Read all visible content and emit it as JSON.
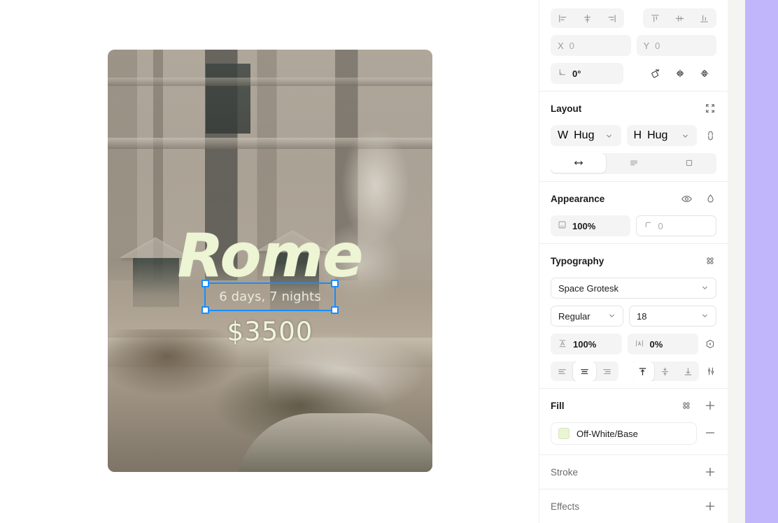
{
  "canvas": {
    "artboard": {
      "title": "Rome",
      "price": "$3500",
      "selected_text": "6 days, 7 nights"
    },
    "selection_color": "#1a8cff",
    "background": "#ffffff"
  },
  "panel": {
    "transform": {
      "align_horizontal": [
        {
          "name": "align-left-icon",
          "label": "Align left"
        },
        {
          "name": "align-center-horizontal-icon",
          "label": "Align horizontal centers"
        },
        {
          "name": "align-right-icon",
          "label": "Align right"
        }
      ],
      "align_vertical": [
        {
          "name": "align-top-icon",
          "label": "Align top"
        },
        {
          "name": "align-center-vertical-icon",
          "label": "Align vertical centers"
        },
        {
          "name": "align-bottom-icon",
          "label": "Align bottom"
        }
      ],
      "x": {
        "label": "X",
        "value": "0"
      },
      "y": {
        "label": "Y",
        "value": "0"
      },
      "rotation": {
        "label": "rotation-icon",
        "value": "0°"
      },
      "tools": [
        {
          "name": "rotate-icon",
          "label": "Rotate"
        },
        {
          "name": "flip-horizontal-icon",
          "label": "Flip horizontal"
        },
        {
          "name": "flip-vertical-icon",
          "label": "Flip vertical"
        }
      ]
    },
    "layout": {
      "title": "Layout",
      "collapse_icon": "collapse-arrows-icon",
      "width": {
        "label": "W",
        "value": "Hug"
      },
      "height": {
        "label": "H",
        "value": "Hug"
      },
      "link_icon": "link-dimensions-icon",
      "modes": [
        {
          "name": "resize-horizontal-icon",
          "active": true
        },
        {
          "name": "text-lines-icon",
          "active": false
        },
        {
          "name": "clip-content-icon",
          "active": false
        }
      ]
    },
    "appearance": {
      "title": "Appearance",
      "visibility_icon": "eye-icon",
      "blend_icon": "blend-drop-icon",
      "opacity": {
        "icon": "opacity-icon",
        "value": "100%"
      },
      "corner_radius": {
        "icon": "corner-radius-icon",
        "value": "0"
      }
    },
    "typography": {
      "title": "Typography",
      "options_icon": "typography-settings-icon",
      "font_family": "Space Grotesk",
      "font_weight": "Regular",
      "font_size": "18",
      "line_height": {
        "icon": "line-height-icon",
        "value": "100%"
      },
      "letter_spacing": {
        "icon": "letter-spacing-icon",
        "value": "0%"
      },
      "list_icon": "text-bullet-icon",
      "align_horizontal": [
        {
          "name": "text-align-left-icon",
          "active": false
        },
        {
          "name": "text-align-center-icon",
          "active": true
        },
        {
          "name": "text-align-right-icon",
          "active": false
        }
      ],
      "align_vertical": [
        {
          "name": "text-align-top-icon",
          "active": true
        },
        {
          "name": "text-align-middle-icon",
          "active": false
        },
        {
          "name": "text-align-bottom-icon",
          "active": false
        }
      ],
      "advanced_icon": "type-settings-icon"
    },
    "fill": {
      "title": "Fill",
      "styles_icon": "fill-styles-icon",
      "add_icon": "add-fill-icon",
      "items": [
        {
          "name": "Off-White/Base",
          "color": "#e9f5d3",
          "remove_icon": "remove-fill-icon"
        }
      ]
    },
    "stroke": {
      "title": "Stroke",
      "add_icon": "add-stroke-icon"
    },
    "effects": {
      "title": "Effects",
      "add_icon": "add-effect-icon"
    }
  },
  "colors": {
    "accent_selection": "#1a8cff",
    "right_strip": "#c1b6fb",
    "gap_strip": "#f4f4f3",
    "text_cream": "#edf5d4"
  }
}
